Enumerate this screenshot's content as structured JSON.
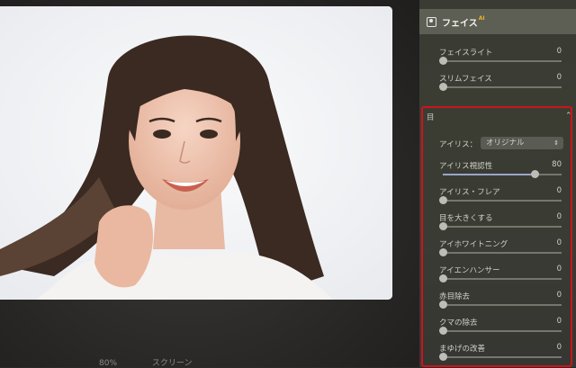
{
  "panel": {
    "title": "フェイス",
    "ai_badge": "AI"
  },
  "face_sliders": [
    {
      "label": "フェイスライト",
      "value": "0",
      "level": 0
    },
    {
      "label": "スリムフェイス",
      "value": "0",
      "level": 0
    }
  ],
  "eyes_section": {
    "label": "目",
    "chevron": "⌃",
    "iris_label": "アイリス：",
    "iris_selected": "オリジナル",
    "sliders": [
      {
        "label": "アイリス視認性",
        "value": "80",
        "level": 0.8
      },
      {
        "label": "アイリス・フレア",
        "value": "0",
        "level": 0
      },
      {
        "label": "目を大きくする",
        "value": "0",
        "level": 0
      },
      {
        "label": "アイホワイトニング",
        "value": "0",
        "level": 0
      },
      {
        "label": "アイエンハンサー",
        "value": "0",
        "level": 0
      },
      {
        "label": "赤目除去",
        "value": "0",
        "level": 0
      },
      {
        "label": "クマの除去",
        "value": "0",
        "level": 0
      },
      {
        "label": "まゆげの改善",
        "value": "0",
        "level": 0
      }
    ]
  },
  "bottom_bar": {
    "zoom": "80%",
    "mode": "スクリーン"
  },
  "colors": {
    "highlight": "#d0121b",
    "slider_fill": "#9aa6c7",
    "ai_badge": "#e6b422"
  }
}
